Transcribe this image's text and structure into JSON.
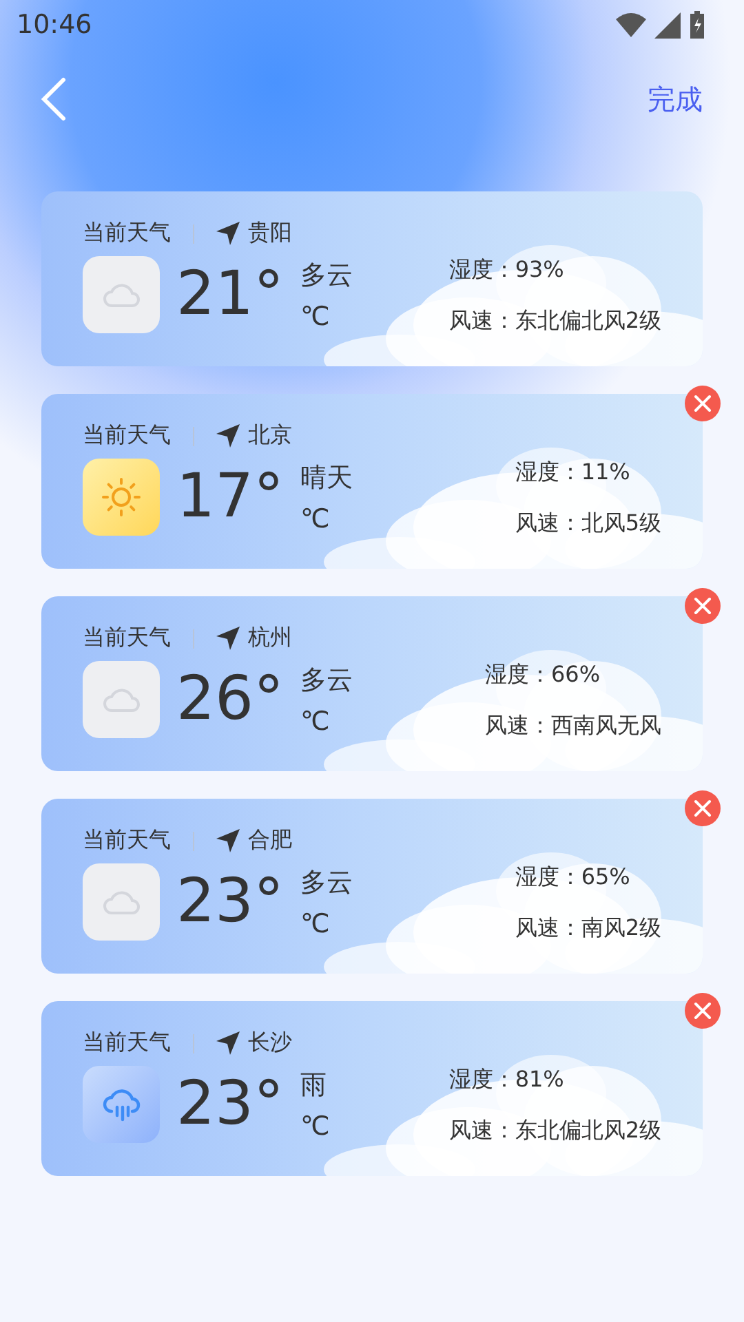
{
  "status_bar": {
    "time": "10:46"
  },
  "nav": {
    "action": "完成"
  },
  "cards": [
    {
      "label": "当前天气",
      "city": "贵阳",
      "temperature": "21°",
      "condition": "多云",
      "unit": "℃",
      "kind": "cloudy",
      "humidity": "湿度：93%",
      "wind": "风速：东北偏北风2级",
      "removable": false
    },
    {
      "label": "当前天气",
      "city": "北京",
      "temperature": "17°",
      "condition": "晴天",
      "unit": "℃",
      "kind": "sunny",
      "humidity": "湿度：11%",
      "wind": "风速：北风5级",
      "removable": true
    },
    {
      "label": "当前天气",
      "city": "杭州",
      "temperature": "26°",
      "condition": "多云",
      "unit": "℃",
      "kind": "cloudy",
      "humidity": "湿度：66%",
      "wind": "风速：西南风无风",
      "removable": true
    },
    {
      "label": "当前天气",
      "city": "合肥",
      "temperature": "23°",
      "condition": "多云",
      "unit": "℃",
      "kind": "cloudy",
      "humidity": "湿度：65%",
      "wind": "风速：南风2级",
      "removable": true
    },
    {
      "label": "当前天气",
      "city": "长沙",
      "temperature": "23°",
      "condition": "雨",
      "unit": "℃",
      "kind": "rain",
      "humidity": "湿度：81%",
      "wind": "风速：东北偏北风2级",
      "removable": true
    }
  ]
}
